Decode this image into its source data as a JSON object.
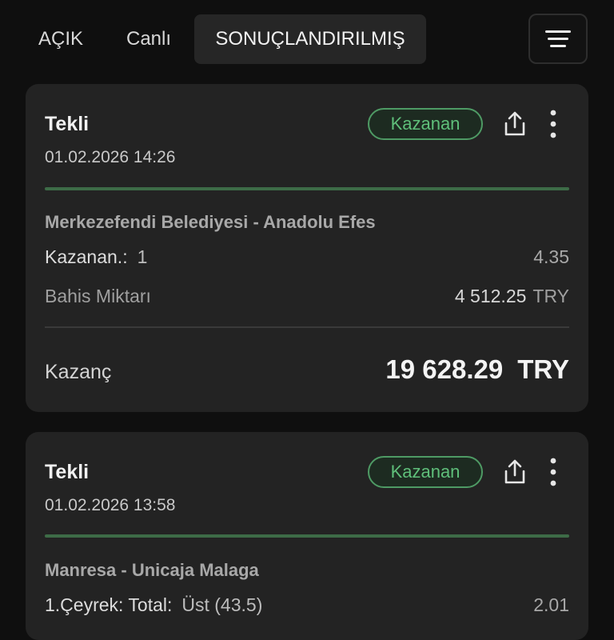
{
  "tabs": [
    {
      "label": "AÇIK",
      "active": false
    },
    {
      "label": "Canlı",
      "active": false
    },
    {
      "label": "SONUÇLANDIRILMIŞ",
      "active": true
    }
  ],
  "filter_button": {
    "icon": "menu-lines-icon"
  },
  "colors": {
    "background": "#0f0f0f",
    "card": "#232323",
    "win_green": "#5fbf7a",
    "divider_green": "#3d6b47"
  },
  "bets": [
    {
      "type": "Tekli",
      "date": "01.02.2026 14:26",
      "status": "Kazanan",
      "match": "Merkezefendi Belediyesi  -  Anadolu Efes",
      "selection_label": "Kazanan.:",
      "selection_value": "1",
      "odds": "4.35",
      "stake_label": "Bahis Miktarı",
      "stake_amount": "4 512.25",
      "stake_currency": "TRY",
      "win_label": "Kazanç",
      "win_amount": "19 628.29",
      "win_currency": "TRY"
    },
    {
      "type": "Tekli",
      "date": "01.02.2026 13:58",
      "status": "Kazanan",
      "match": "Manresa  -  Unicaja Malaga",
      "selection_label": "1.Çeyrek: Total:",
      "selection_value": "Üst (43.5)",
      "odds": "2.01"
    }
  ]
}
